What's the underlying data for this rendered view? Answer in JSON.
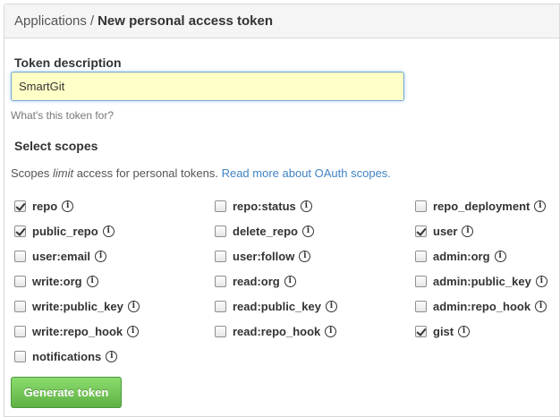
{
  "breadcrumb": {
    "parent": "Applications",
    "separator": "/",
    "current": "New personal access token"
  },
  "token": {
    "label": "Token description",
    "value": "SmartGit",
    "hint": "What's this token for?"
  },
  "scopes": {
    "heading": "Select scopes",
    "desc_prefix": "Scopes ",
    "desc_em": "limit",
    "desc_middle": " access for personal tokens. ",
    "desc_link": "Read more about OAuth scopes.",
    "items": [
      {
        "label": "repo",
        "checked": true
      },
      {
        "label": "repo:status",
        "checked": false
      },
      {
        "label": "repo_deployment",
        "checked": false
      },
      {
        "label": "public_repo",
        "checked": true
      },
      {
        "label": "delete_repo",
        "checked": false
      },
      {
        "label": "user",
        "checked": true
      },
      {
        "label": "user:email",
        "checked": false
      },
      {
        "label": "user:follow",
        "checked": false
      },
      {
        "label": "admin:org",
        "checked": false
      },
      {
        "label": "write:org",
        "checked": false
      },
      {
        "label": "read:org",
        "checked": false
      },
      {
        "label": "admin:public_key",
        "checked": false
      },
      {
        "label": "write:public_key",
        "checked": false
      },
      {
        "label": "read:public_key",
        "checked": false
      },
      {
        "label": "admin:repo_hook",
        "checked": false
      },
      {
        "label": "write:repo_hook",
        "checked": false
      },
      {
        "label": "read:repo_hook",
        "checked": false
      },
      {
        "label": "gist",
        "checked": true
      },
      {
        "label": "notifications",
        "checked": false
      }
    ]
  },
  "info_icon_glyph": "i",
  "generate_button": "Generate token",
  "colors": {
    "link": "#4183c4",
    "input_bg": "#ffffc8",
    "button_green": "#60b044"
  }
}
